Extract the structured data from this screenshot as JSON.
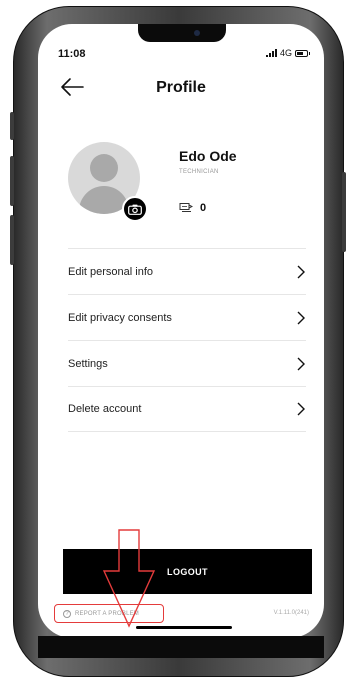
{
  "status_bar": {
    "time": "11:08",
    "network": "4G"
  },
  "header": {
    "title": "Profile"
  },
  "profile": {
    "name": "Edo Ode",
    "role": "TECHNICIAN",
    "points": "0"
  },
  "menu": {
    "items": [
      {
        "label": "Edit personal info"
      },
      {
        "label": "Edit privacy consents"
      },
      {
        "label": "Settings"
      },
      {
        "label": "Delete account"
      }
    ]
  },
  "actions": {
    "logout_label": "LOGOUT"
  },
  "footer": {
    "report_label": "REPORT A PROBLEM",
    "version": "V.1.11.0(241)"
  },
  "colors": {
    "primary": "#000000",
    "annotation": "#e43b3b",
    "avatar_bg": "#d9d9d9"
  },
  "icons": [
    "back-arrow-icon",
    "camera-icon",
    "points-icon",
    "chevron-right-icon",
    "question-icon",
    "signal-icon",
    "battery-icon"
  ]
}
